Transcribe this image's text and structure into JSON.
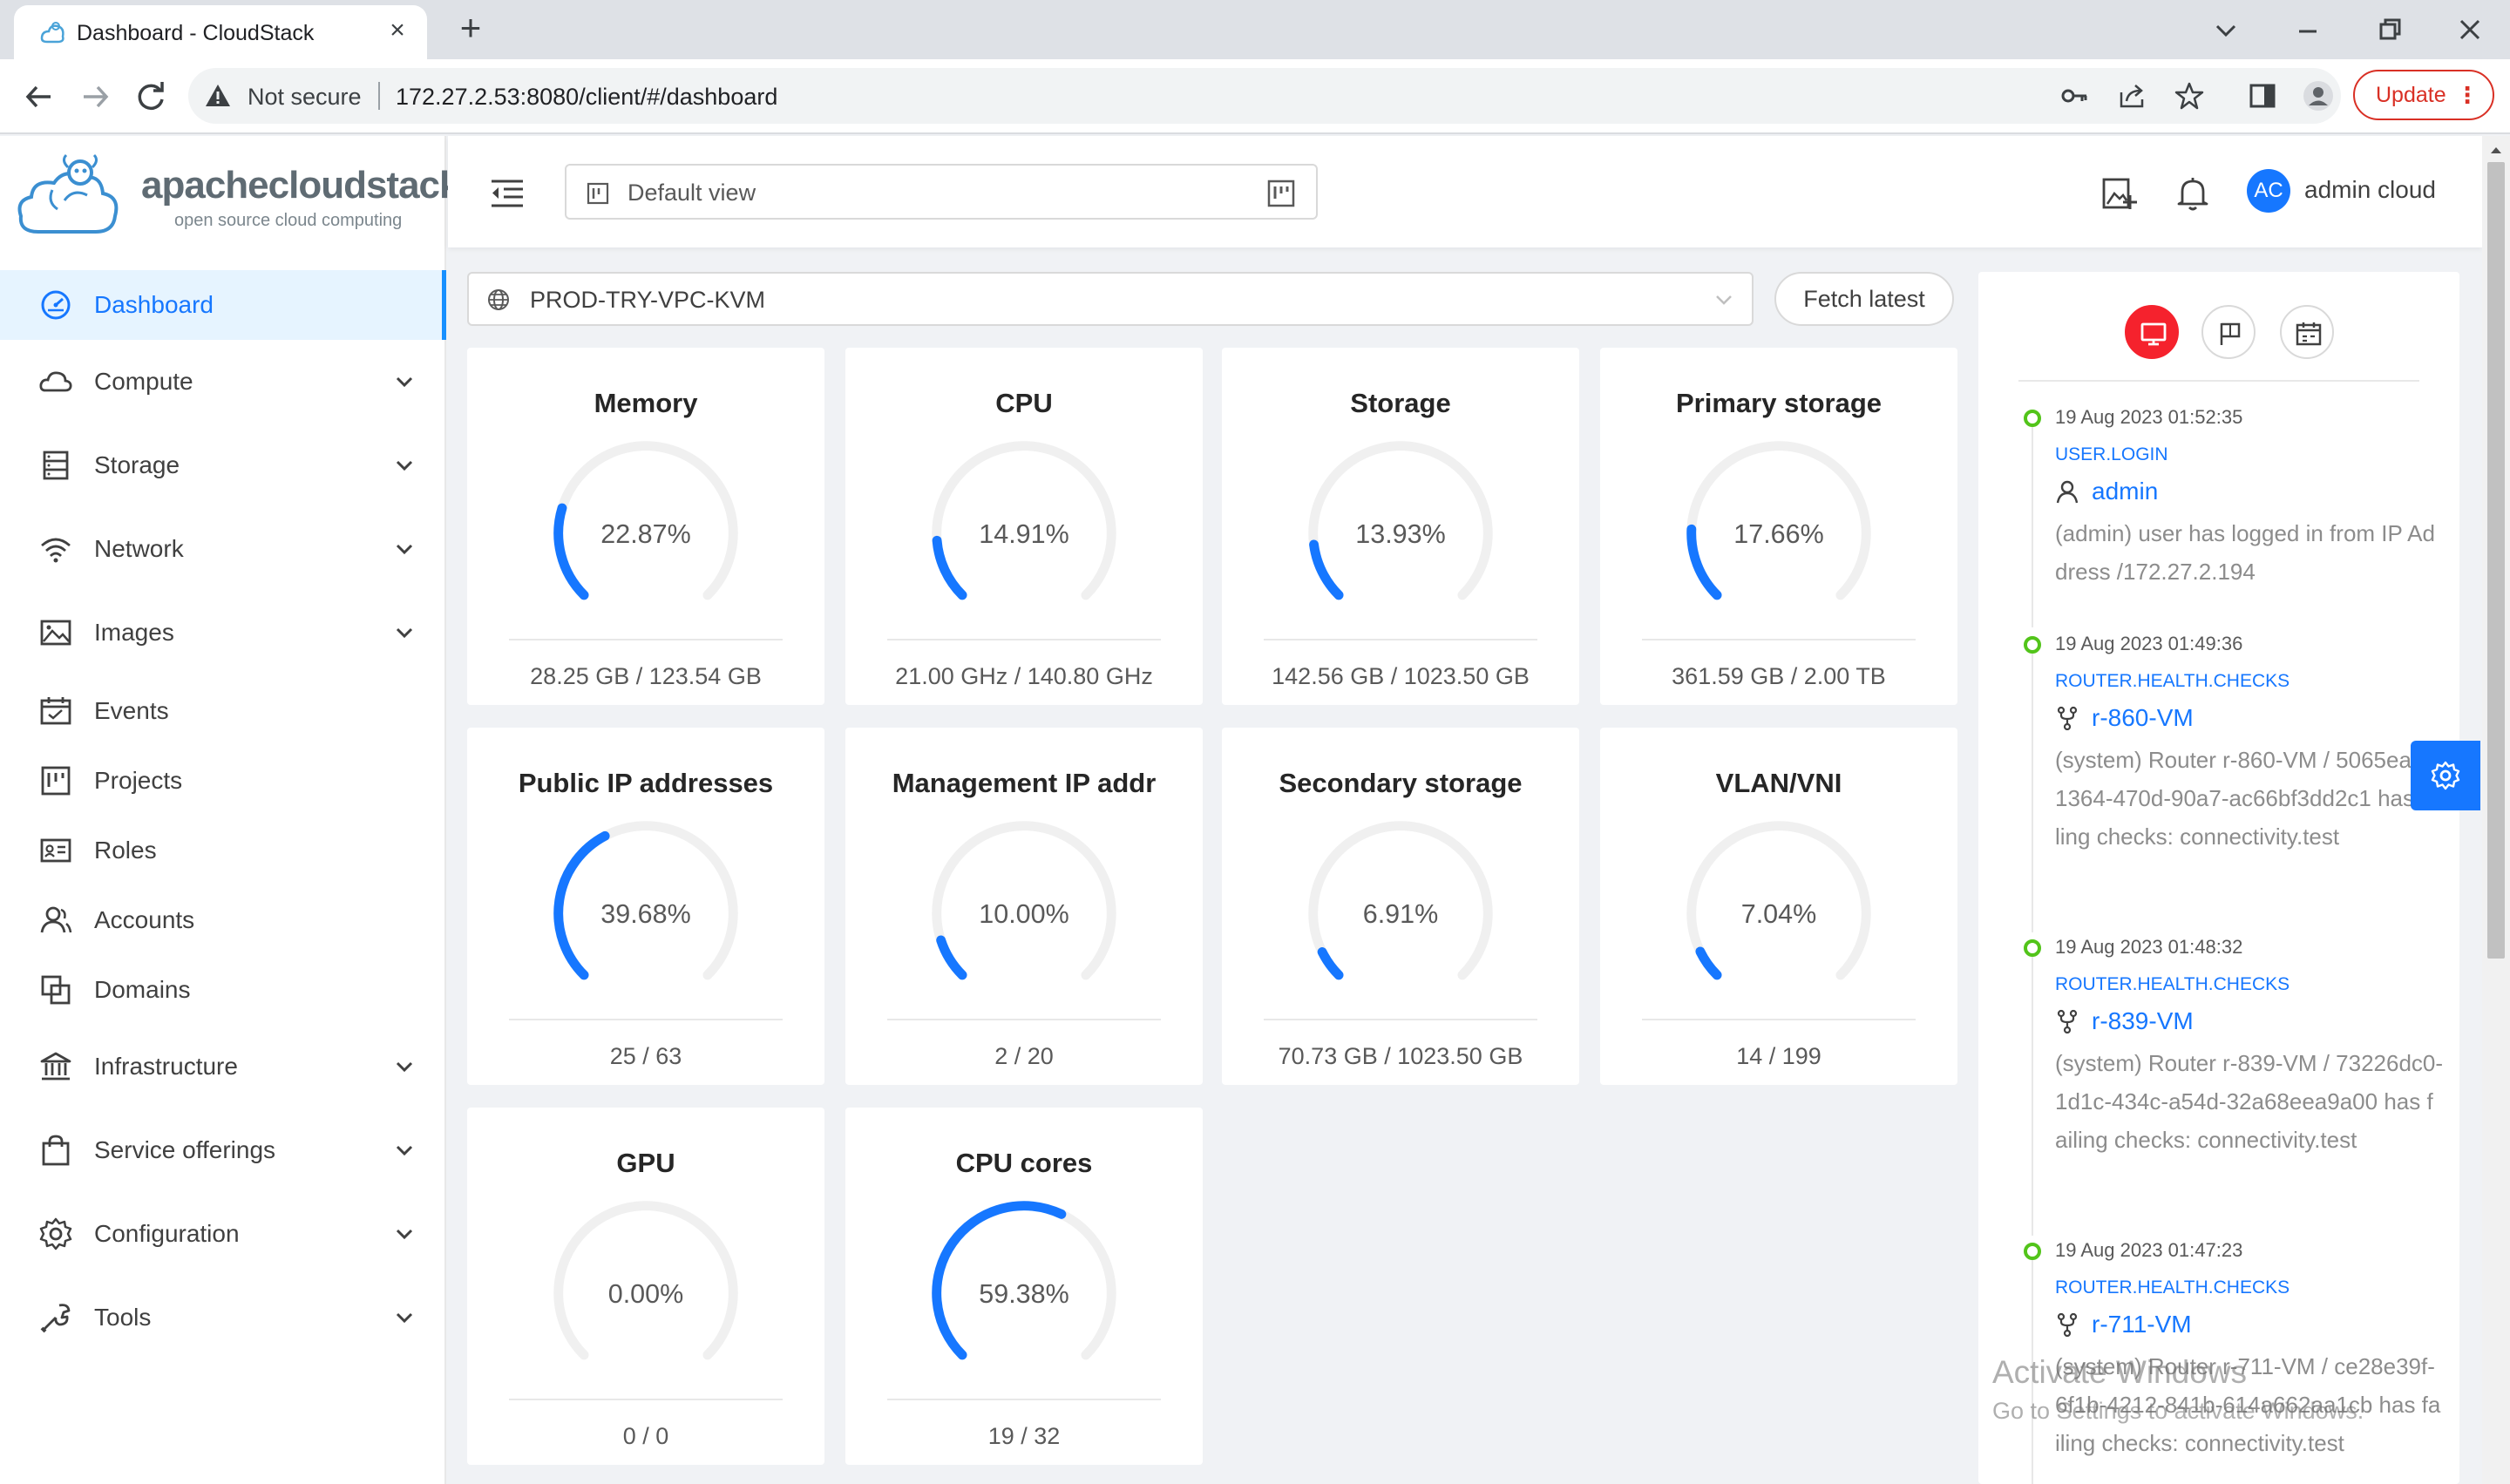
{
  "browser": {
    "tab_title": "Dashboard - CloudStack",
    "not_secure": "Not secure",
    "url": "172.27.2.53:8080/client/#/dashboard",
    "update_label": "Update"
  },
  "app": {
    "logo_text": "apachecloudstack",
    "logo_sub": "open source cloud computing",
    "view_label": "Default view",
    "user_initials": "AC",
    "user_name": "admin cloud",
    "zone": "PROD-TRY-VPC-KVM",
    "fetch_label": "Fetch latest"
  },
  "sidebar": {
    "items": [
      {
        "label": "Dashboard",
        "icon": "dashboard-icon"
      },
      {
        "label": "Compute",
        "icon": "cloud-icon"
      },
      {
        "label": "Storage",
        "icon": "database-icon"
      },
      {
        "label": "Network",
        "icon": "wifi-icon"
      },
      {
        "label": "Images",
        "icon": "picture-icon"
      },
      {
        "label": "Events",
        "icon": "schedule-icon"
      },
      {
        "label": "Projects",
        "icon": "project-icon"
      },
      {
        "label": "Roles",
        "icon": "idcard-icon"
      },
      {
        "label": "Accounts",
        "icon": "team-icon"
      },
      {
        "label": "Domains",
        "icon": "block-icon"
      },
      {
        "label": "Infrastructure",
        "icon": "bank-icon"
      },
      {
        "label": "Service offerings",
        "icon": "shopping-icon"
      },
      {
        "label": "Configuration",
        "icon": "setting-icon"
      },
      {
        "label": "Tools",
        "icon": "tool-icon"
      }
    ]
  },
  "cards": [
    {
      "title": "Memory",
      "percent_label": "22.87%",
      "percent": 22.87,
      "value": "28.25 GB / 123.54 GB"
    },
    {
      "title": "CPU",
      "percent_label": "14.91%",
      "percent": 14.91,
      "value": "21.00 GHz / 140.80 GHz"
    },
    {
      "title": "Storage",
      "percent_label": "13.93%",
      "percent": 13.93,
      "value": "142.56 GB / 1023.50 GB"
    },
    {
      "title": "Primary storage",
      "percent_label": "17.66%",
      "percent": 17.66,
      "value": "361.59 GB / 2.00 TB"
    },
    {
      "title": "Public IP addresses",
      "percent_label": "39.68%",
      "percent": 39.68,
      "value": "25 / 63"
    },
    {
      "title": "Management IP addr",
      "percent_label": "10.00%",
      "percent": 10.0,
      "value": "2 / 20"
    },
    {
      "title": "Secondary storage",
      "percent_label": "6.91%",
      "percent": 6.91,
      "value": "70.73 GB / 1023.50 GB"
    },
    {
      "title": "VLAN/VNI",
      "percent_label": "7.04%",
      "percent": 7.04,
      "value": "14 / 199"
    },
    {
      "title": "GPU",
      "percent_label": "0.00%",
      "percent": 0.0,
      "value": "0 / 0"
    },
    {
      "title": "CPU cores",
      "percent_label": "59.38%",
      "percent": 59.38,
      "value": "19 / 32"
    }
  ],
  "events": [
    {
      "time": "19 Aug 2023 01:52:35",
      "type": "USER.LOGIN",
      "resource": "admin",
      "resource_icon": "user-icon",
      "description": "(admin) user has logged in from IP Address /172.27.2.194"
    },
    {
      "time": "19 Aug 2023 01:49:36",
      "type": "ROUTER.HEALTH.CHECKS",
      "resource": "r-860-VM",
      "resource_icon": "fork-icon",
      "description": "(system) Router r-860-VM / 5065ea1d-1364-470d-90a7-ac66bf3dd2c1 has failing checks: connectivity.test"
    },
    {
      "time": "19 Aug 2023 01:48:32",
      "type": "ROUTER.HEALTH.CHECKS",
      "resource": "r-839-VM",
      "resource_icon": "fork-icon",
      "description": "(system) Router r-839-VM / 73226dc0-1d1c-434c-a54d-32a68eea9a00 has failing checks: connectivity.test"
    },
    {
      "time": "19 Aug 2023 01:47:23",
      "type": "ROUTER.HEALTH.CHECKS",
      "resource": "r-711-VM",
      "resource_icon": "fork-icon",
      "description": "(system) Router r-711-VM / ce28e39f-6f1b-4212-841b-614a662aa1cb has failing checks: connectivity.test"
    }
  ],
  "watermark": {
    "line1": "Activate Windows",
    "line2": "Go to Settings to activate Windows."
  },
  "colors": {
    "accent": "#1677ff",
    "gauge_track": "#f0f0f0",
    "event_dot": "#52c41a",
    "active_tab": "#f5222d"
  }
}
